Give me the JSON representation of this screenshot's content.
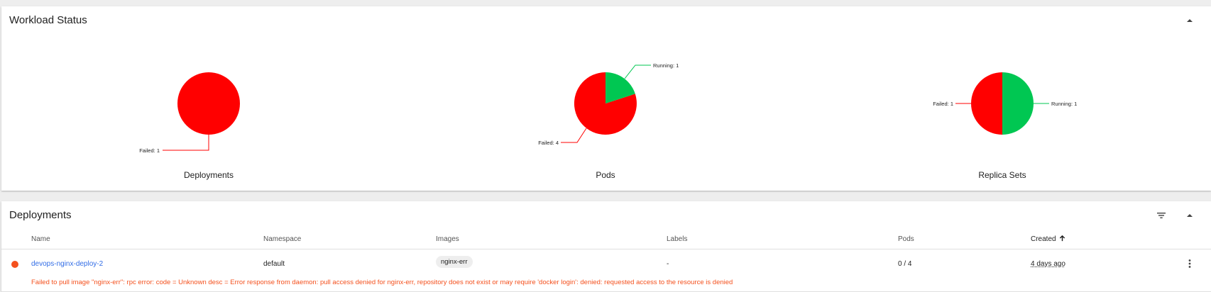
{
  "workload": {
    "title": "Workload Status",
    "charts": [
      {
        "caption": "Deployments",
        "slices": [
          {
            "label": "Failed: 1",
            "value": 1,
            "color": "#ff0000"
          }
        ]
      },
      {
        "caption": "Pods",
        "slices": [
          {
            "label": "Failed: 4",
            "value": 4,
            "color": "#ff0000"
          },
          {
            "label": "Running: 1",
            "value": 1,
            "color": "#00c752"
          }
        ]
      },
      {
        "caption": "Replica Sets",
        "slices": [
          {
            "label": "Failed: 1",
            "value": 1,
            "color": "#ff0000"
          },
          {
            "label": "Running: 1",
            "value": 1,
            "color": "#00c752"
          }
        ]
      }
    ]
  },
  "chart_data": [
    {
      "type": "pie",
      "title": "Deployments",
      "categories": [
        "Failed"
      ],
      "values": [
        1
      ]
    },
    {
      "type": "pie",
      "title": "Pods",
      "categories": [
        "Failed",
        "Running"
      ],
      "values": [
        4,
        1
      ]
    },
    {
      "type": "pie",
      "title": "Replica Sets",
      "categories": [
        "Failed",
        "Running"
      ],
      "values": [
        1,
        1
      ]
    }
  ],
  "deployments": {
    "title": "Deployments",
    "columns": {
      "name": "Name",
      "namespace": "Namespace",
      "images": "Images",
      "labels": "Labels",
      "pods": "Pods",
      "created": "Created"
    },
    "sort_icon": "arrow-up-icon",
    "rows": [
      {
        "name": "devops-nginx-deploy-2",
        "namespace": "default",
        "image": "nginx-err",
        "labels": "-",
        "pods": "0 / 4",
        "created": "4 days ago",
        "status_color": "#f4511e",
        "error": "Failed to pull image \"nginx-err\": rpc error: code = Unknown desc = Error response from daemon: pull access denied for nginx-err, repository does not exist or may require 'docker login': denied: requested access to the resource is denied"
      }
    ]
  },
  "colors": {
    "failed": "#ff0000",
    "running": "#00c752",
    "error_text": "#f4511e",
    "link": "#326de6"
  }
}
